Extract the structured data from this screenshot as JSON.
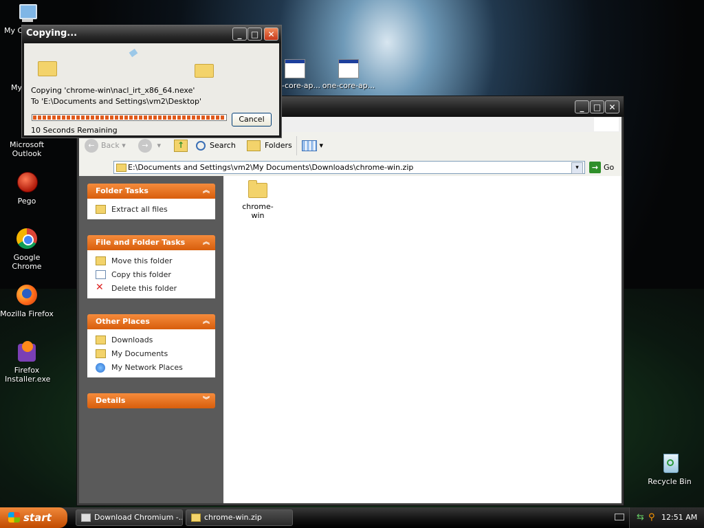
{
  "desktop": {
    "icons": [
      {
        "label": "My C"
      },
      {
        "label": "My"
      },
      {
        "label": "Microsoft Outlook"
      },
      {
        "label": "Pego"
      },
      {
        "label": "Google Chrome"
      },
      {
        "label": "Mozilla Firefox"
      },
      {
        "label": "Firefox Installer.exe"
      },
      {
        "label": "-core-ap..."
      },
      {
        "label": "one-core-ap..."
      },
      {
        "label": "Recycle Bin"
      }
    ]
  },
  "copy_dialog": {
    "title": "Copying...",
    "copying_text": "Copying 'chrome-win\\nacl_irt_x86_64.nexe'",
    "to_text": "To 'E:\\Documents and Settings\\vm2\\Desktop'",
    "remaining": "10 Seconds Remaining",
    "cancel_label": "Cancel",
    "progress_fraction": 1.0
  },
  "explorer": {
    "toolbar": {
      "back_label": "Back",
      "search_label": "Search",
      "folders_label": "Folders"
    },
    "address": {
      "value": "E:\\Documents and Settings\\vm2\\My Documents\\Downloads\\chrome-win.zip",
      "go_label": "Go"
    },
    "sections": {
      "folder_tasks": {
        "title": "Folder Tasks",
        "items": [
          "Extract all files"
        ]
      },
      "file_folder_tasks": {
        "title": "File and Folder Tasks",
        "items": [
          "Move this folder",
          "Copy this folder",
          "Delete this folder"
        ]
      },
      "other_places": {
        "title": "Other Places",
        "items": [
          "Downloads",
          "My Documents",
          "My Network Places"
        ]
      },
      "details": {
        "title": "Details"
      }
    },
    "files": [
      {
        "name": "chrome-win"
      }
    ]
  },
  "taskbar": {
    "start_label": "start",
    "tasks": [
      {
        "label": "Download Chromium -..."
      },
      {
        "label": "chrome-win.zip"
      }
    ],
    "clock": "12:51 AM"
  },
  "colors": {
    "task_header": "#e8741e",
    "taskbar": "#1a1a1a",
    "start": "#e0701f"
  }
}
